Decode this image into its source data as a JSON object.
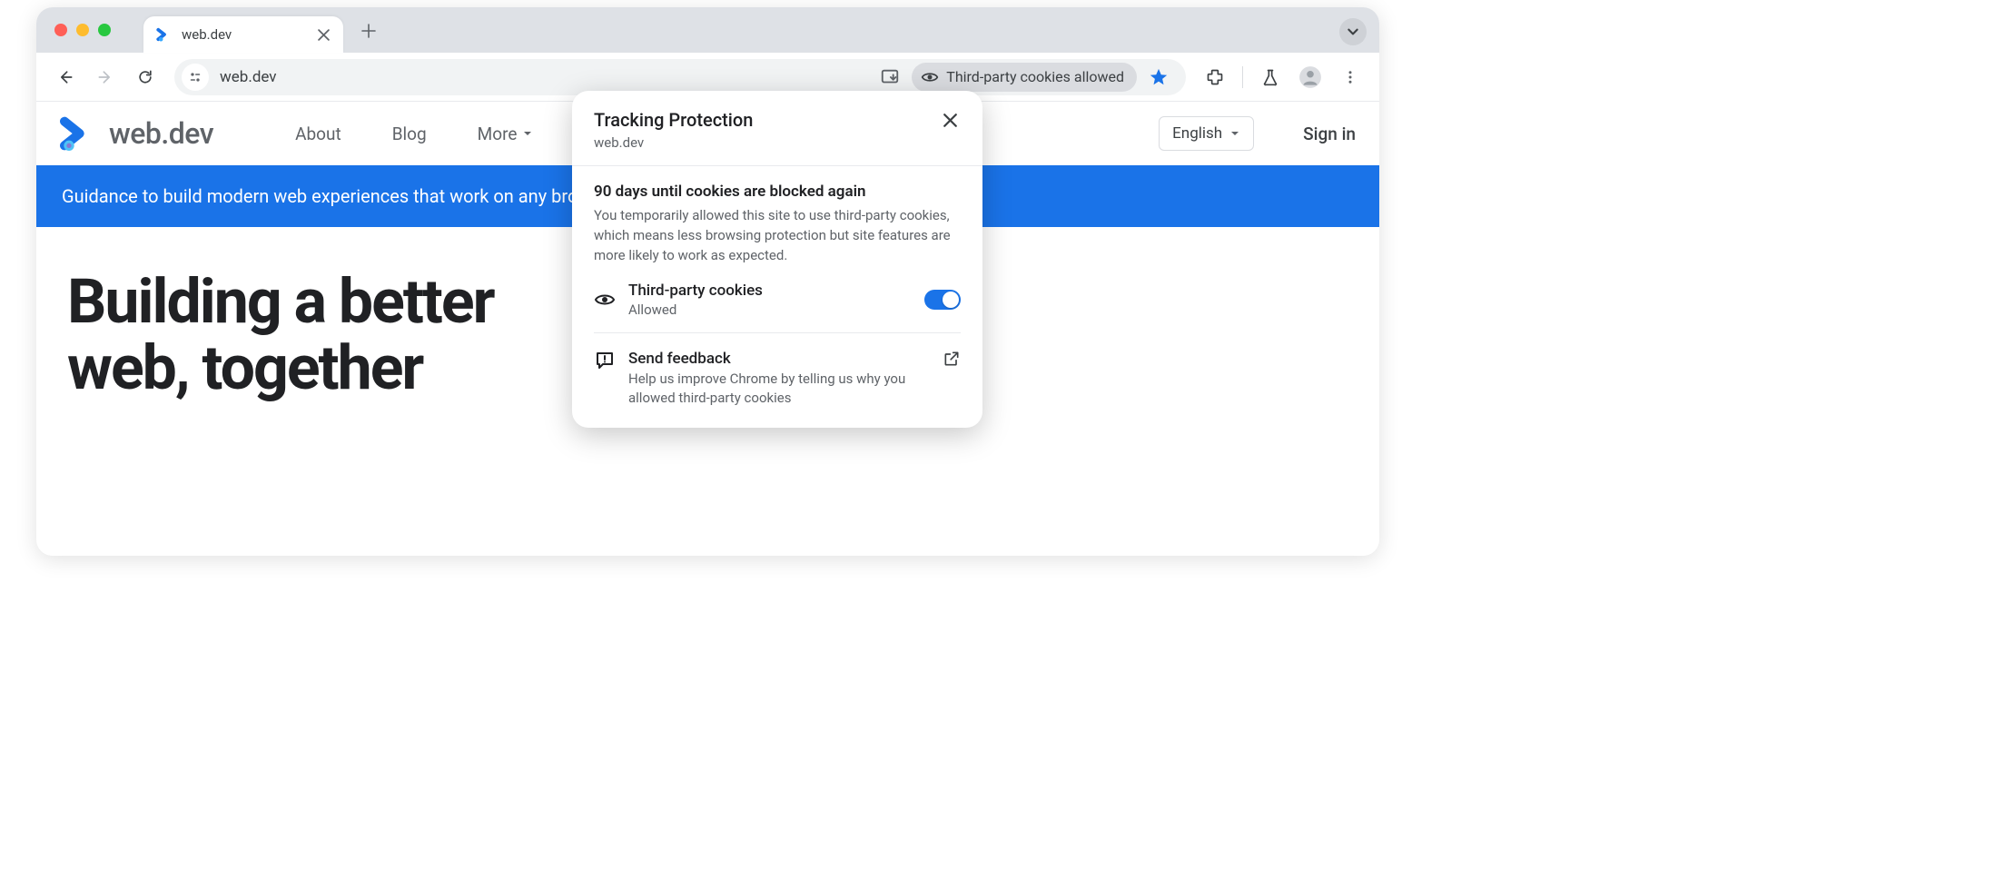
{
  "window": {
    "tab_title": "web.dev"
  },
  "toolbar": {
    "url": "web.dev",
    "cookies_pill": "Third-party cookies allowed"
  },
  "site": {
    "logo_text": "web.dev",
    "nav": {
      "about": "About",
      "blog": "Blog",
      "more": "More"
    },
    "language": "English",
    "signin": "Sign in",
    "banner": "Guidance to build modern web experiences that work on any browser.",
    "hero_line1": "Building a better",
    "hero_line2": "web, together"
  },
  "popover": {
    "title": "Tracking Protection",
    "site": "web.dev",
    "countdown_title": "90 days until cookies are blocked again",
    "countdown_body": "You temporarily allowed this site to use third-party cookies, which means less browsing protection but site features are more likely to work as expected.",
    "cookie_label": "Third-party cookies",
    "cookie_status": "Allowed",
    "feedback_title": "Send feedback",
    "feedback_body": "Help us improve Chrome by telling us why you allowed third-party cookies"
  }
}
